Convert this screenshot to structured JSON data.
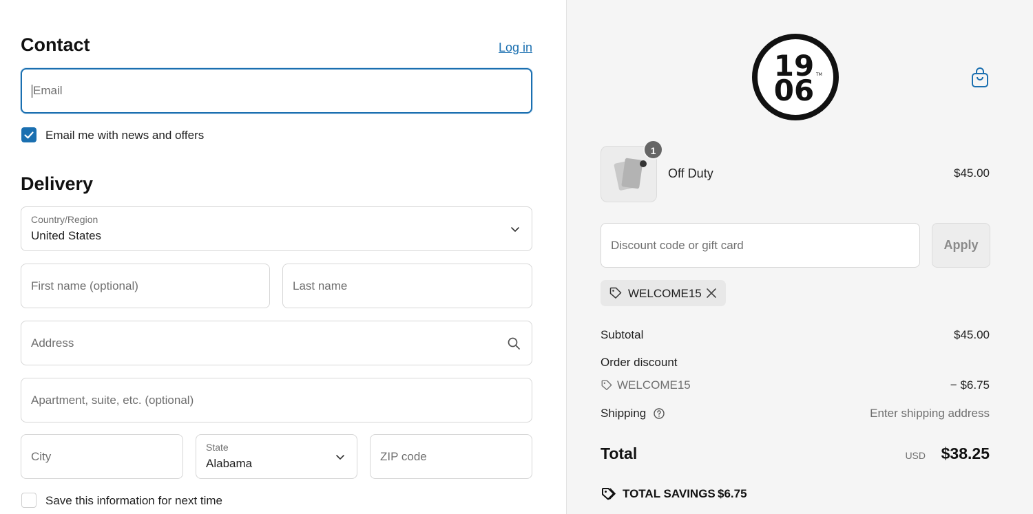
{
  "contact": {
    "heading": "Contact",
    "login_label": "Log in",
    "email_placeholder": "Email",
    "newsletter_label": "Email me with news and offers",
    "newsletter_checked": true
  },
  "delivery": {
    "heading": "Delivery",
    "country_label": "Country/Region",
    "country_value": "United States",
    "first_name_placeholder": "First name (optional)",
    "last_name_placeholder": "Last name",
    "address_placeholder": "Address",
    "apartment_placeholder": "Apartment, suite, etc. (optional)",
    "city_placeholder": "City",
    "state_label": "State",
    "state_value": "Alabama",
    "zip_placeholder": "ZIP code",
    "save_info_label": "Save this information for next time",
    "save_info_checked": false
  },
  "summary": {
    "logo_text_top": "19",
    "logo_text_bottom": "06",
    "logo_tm": "TM",
    "item": {
      "name": "Off Duty",
      "price": "$45.00",
      "quantity": "1"
    },
    "discount_placeholder": "Discount code or gift card",
    "apply_label": "Apply",
    "applied_code": "WELCOME15",
    "subtotal_label": "Subtotal",
    "subtotal_value": "$45.00",
    "order_discount_label": "Order discount",
    "discount_code": "WELCOME15",
    "discount_value": "− $6.75",
    "shipping_label": "Shipping",
    "shipping_value": "Enter shipping address",
    "total_label": "Total",
    "total_currency": "USD",
    "total_value": "$38.25",
    "savings_label": "TOTAL SAVINGS",
    "savings_value": "$6.75"
  },
  "colors": {
    "accent": "#1a6fb0",
    "sidebar_bg": "#f5f5f5"
  }
}
